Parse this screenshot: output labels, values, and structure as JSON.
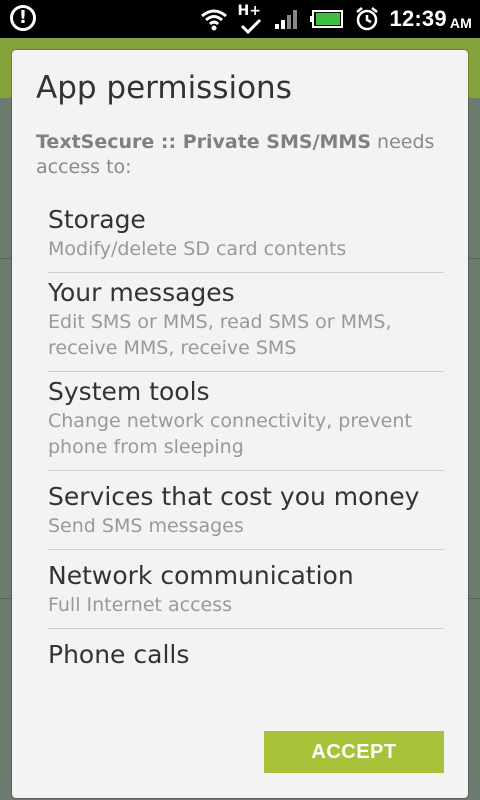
{
  "status_bar": {
    "time": "12:39",
    "ampm": "AM",
    "network_label": "H+",
    "icons": [
      "alert-icon",
      "wifi-icon",
      "data-h-plus-icon",
      "signal-icon",
      "battery-icon",
      "alarm-icon"
    ]
  },
  "dialog": {
    "title": "App permissions",
    "app_name": "TextSecure :: Private SMS/MMS",
    "needs_text": " needs access to:",
    "permissions": [
      {
        "title": "Storage",
        "desc": "Modify/delete SD card contents"
      },
      {
        "title": "Your messages",
        "desc": "Edit SMS or MMS, read SMS or MMS, receive MMS, receive SMS"
      },
      {
        "title": "System tools",
        "desc": "Change network connectivity, prevent phone from sleeping"
      },
      {
        "title": "Services that cost you money",
        "desc": "Send SMS messages"
      },
      {
        "title": "Network communication",
        "desc": "Full Internet access"
      },
      {
        "title": "Phone calls",
        "desc": ""
      }
    ],
    "accept_label": "ACCEPT"
  },
  "colors": {
    "accent": "#a8c23a",
    "dialog_bg": "#f3f3f3",
    "status_bar": "#000000"
  }
}
